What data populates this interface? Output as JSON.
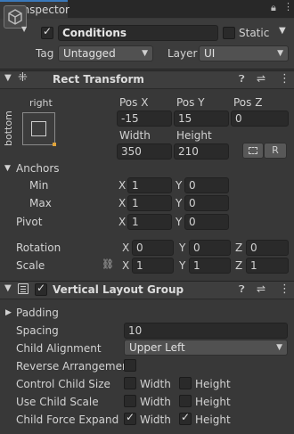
{
  "tab": {
    "label": "Inspector"
  },
  "object": {
    "active": true,
    "name": "Conditions",
    "static_label": "Static",
    "static": false,
    "tag_label": "Tag",
    "tag_value": "Untagged",
    "layer_label": "Layer",
    "layer_value": "UI"
  },
  "rect": {
    "title": "Rect Transform",
    "anchor_h": "right",
    "anchor_v": "bottom",
    "posx_label": "Pos X",
    "posy_label": "Pos Y",
    "posz_label": "Pos Z",
    "posx": "-15",
    "posy": "15",
    "posz": "0",
    "width_label": "Width",
    "height_label": "Height",
    "width": "350",
    "height": "210",
    "r_button": "R",
    "anchors_label": "Anchors",
    "min_label": "Min",
    "max_label": "Max",
    "min_x": "1",
    "min_y": "0",
    "max_x": "1",
    "max_y": "0",
    "pivot_label": "Pivot",
    "pivot_x": "1",
    "pivot_y": "0",
    "rotation_label": "Rotation",
    "rot_x": "0",
    "rot_y": "0",
    "rot_z": "0",
    "scale_label": "Scale",
    "scale_x": "1",
    "scale_y": "1",
    "scale_z": "1",
    "x": "X",
    "y": "Y",
    "z": "Z"
  },
  "vlg": {
    "title": "Vertical Layout Group",
    "enabled": true,
    "padding_label": "Padding",
    "spacing_label": "Spacing",
    "spacing": "10",
    "alignment_label": "Child Alignment",
    "alignment": "Upper Left",
    "reverse_label": "Reverse Arrangement",
    "control_label": "Control Child Size",
    "use_scale_label": "Use Child Scale",
    "force_label": "Child Force Expand",
    "width": "Width",
    "height": "Height"
  }
}
